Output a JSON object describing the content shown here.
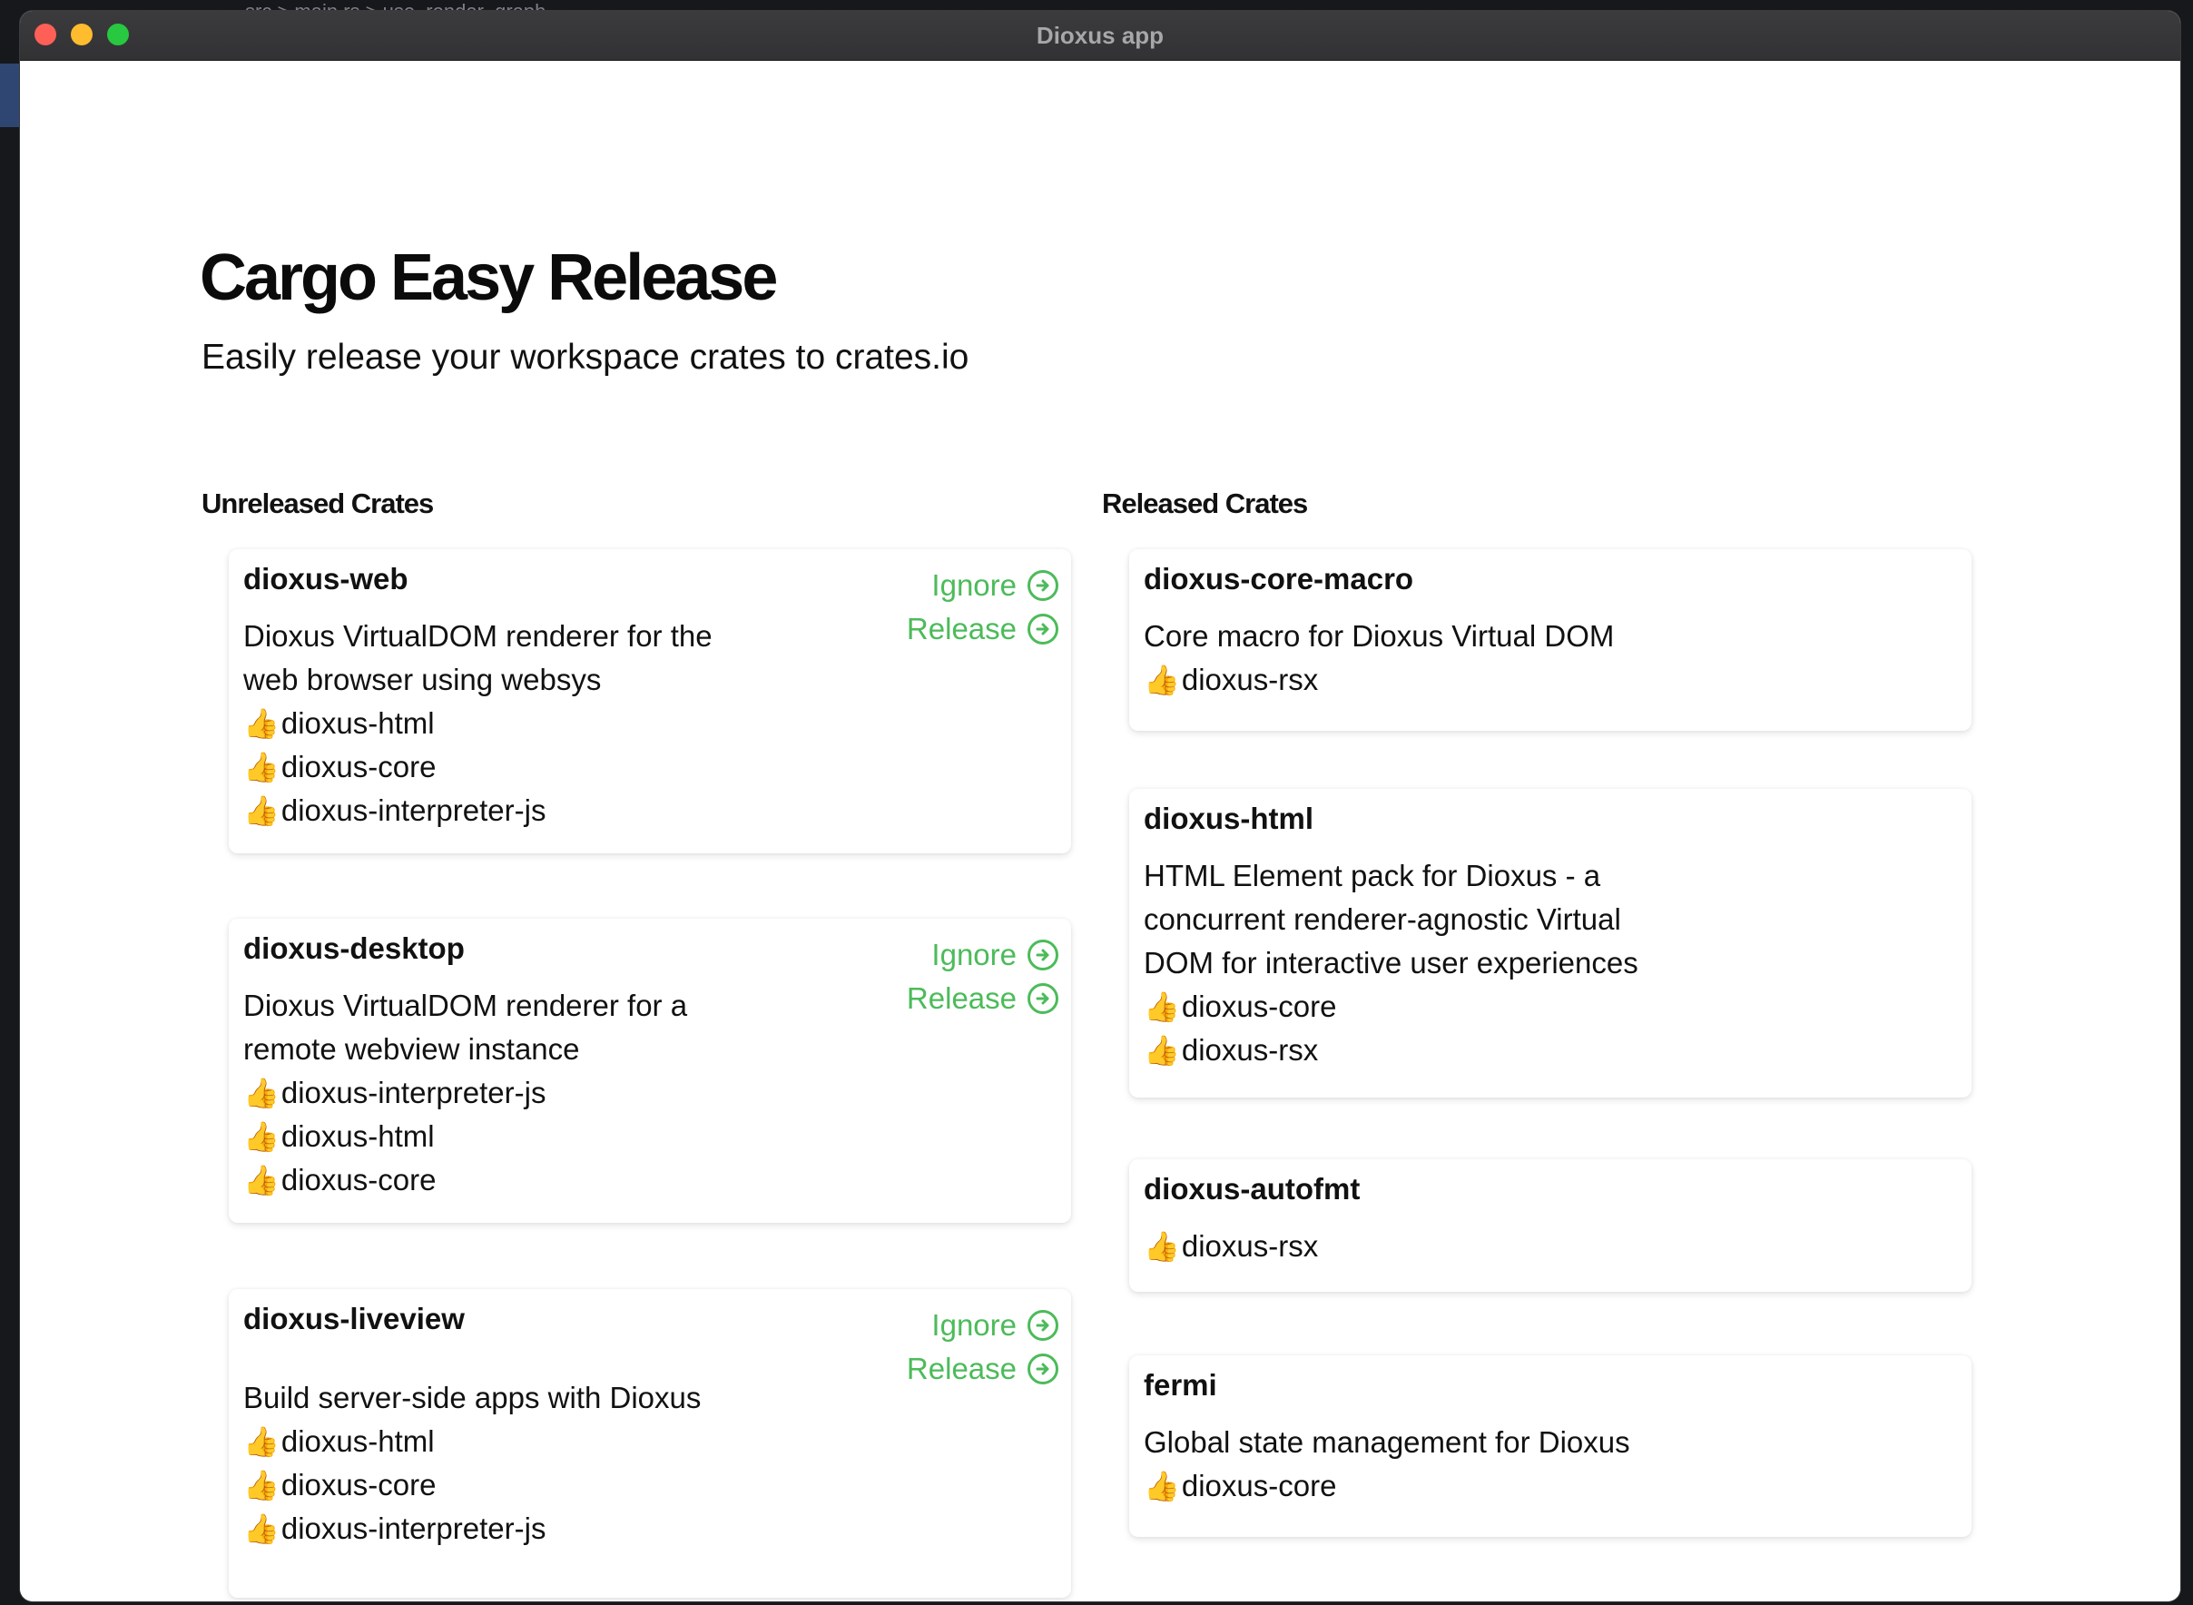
{
  "window": {
    "title": "Dioxus app"
  },
  "background": {
    "breadcrumb": "src > main.rs > use_render_graph"
  },
  "app": {
    "title": "Cargo Easy Release",
    "subtitle": "Easily release your workspace crates to crates.io"
  },
  "columns": {
    "unreleased_heading": "Unreleased Crates",
    "released_heading": "Released Crates"
  },
  "actions": {
    "ignore_label": "Ignore",
    "release_label": "Release"
  },
  "icons": {
    "dependency": "thumbs-up-icon",
    "action": "arrow-right-circle-icon"
  },
  "colors": {
    "accent": "#4cbb5a",
    "text": "#111111",
    "titlebar": "#353537"
  },
  "unreleased": [
    {
      "name": "dioxus-web",
      "desc1": "Dioxus VirtualDOM renderer for the",
      "desc2": "web browser using websys",
      "deps": [
        "dioxus-html",
        "dioxus-core",
        "dioxus-interpreter-js"
      ]
    },
    {
      "name": "dioxus-desktop",
      "desc1": "Dioxus VirtualDOM renderer for a",
      "desc2": "remote webview instance",
      "deps": [
        "dioxus-interpreter-js",
        "dioxus-html",
        "dioxus-core"
      ]
    },
    {
      "name": "dioxus-liveview",
      "desc1": "Build server-side apps with Dioxus",
      "deps": [
        "dioxus-html",
        "dioxus-core",
        "dioxus-interpreter-js"
      ]
    }
  ],
  "released": [
    {
      "name": "dioxus-core-macro",
      "desc1": "Core macro for Dioxus Virtual DOM",
      "deps": [
        "dioxus-rsx"
      ]
    },
    {
      "name": "dioxus-html",
      "desc1": "HTML Element pack for Dioxus - a",
      "desc2": "concurrent renderer-agnostic Virtual",
      "desc3": "DOM for interactive user experiences",
      "deps": [
        "dioxus-core",
        "dioxus-rsx"
      ]
    },
    {
      "name": "dioxus-autofmt",
      "deps": [
        "dioxus-rsx"
      ]
    },
    {
      "name": "fermi",
      "desc1": "Global state management for Dioxus",
      "deps": [
        "dioxus-core"
      ]
    }
  ]
}
